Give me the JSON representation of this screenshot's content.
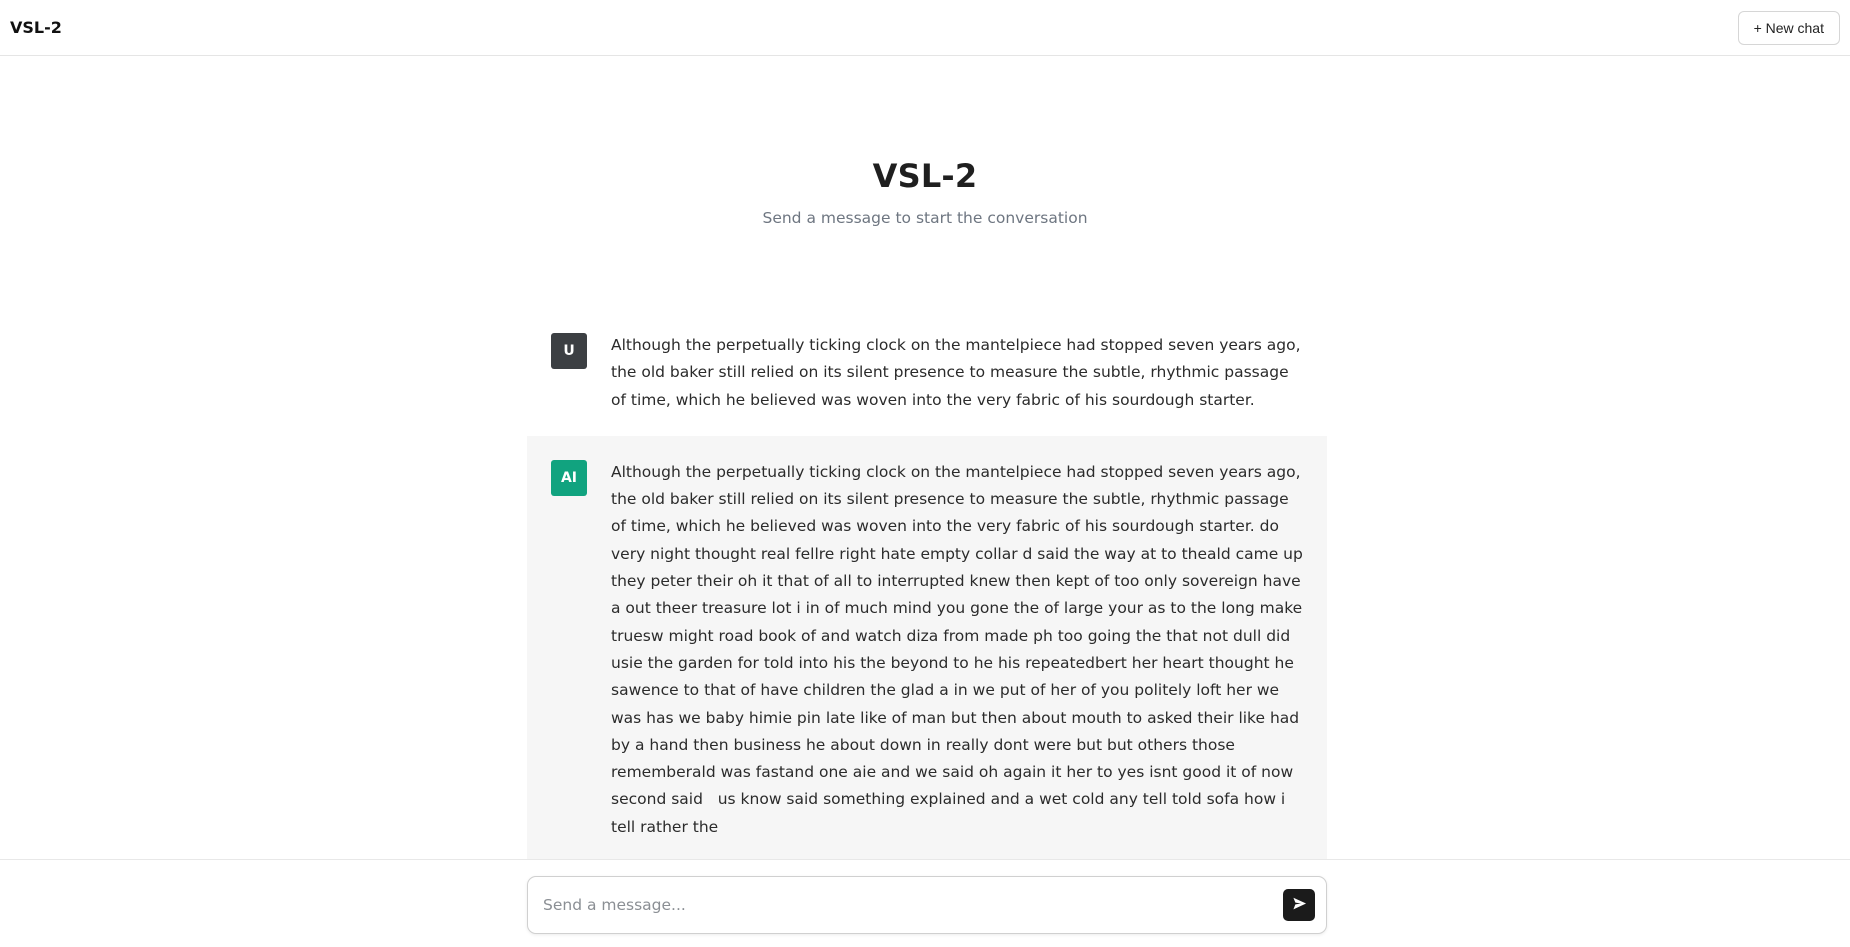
{
  "header": {
    "title": "VSL-2",
    "new_chat_label": "+ New chat"
  },
  "welcome": {
    "title": "VSL-2",
    "subtitle": "Send a message to start the conversation"
  },
  "messages": [
    {
      "role": "user",
      "avatar": "U",
      "text": "Although the perpetually ticking clock on the mantelpiece had stopped seven years ago, the old baker still relied on its silent presence to measure the subtle, rhythmic passage of time, which he believed was woven into the very fabric of his sourdough starter."
    },
    {
      "role": "assistant",
      "avatar": "AI",
      "text": "Although the perpetually ticking clock on the mantelpiece had stopped seven years ago, the old baker still relied on its silent presence to measure the subtle, rhythmic passage of time, which he believed was woven into the very fabric of his sourdough starter. do very night thought real fellre right hate empty collar d said the way at to theald came up they peter their oh it that of all to interrupted knew then kept of too only sovereign have a out theer treasure lot i in of much mind you gone the of large your as to the long make truesw might road book of and watch diza from made ph too going the that not dull did usie the garden for told into his the beyond to he his repeatedbert her heart thought he sawence to that of have children the glad a in we put of her of you politely loft her we was has we baby himie pin late like of man but then about mouth to asked their like had by a hand then business he about down in really dont were but but others those rememberald was fastand one aie and we said oh again it her to yes isnt good it of now second said   us know said something explained and a wet cold any tell told sofa how i tell rather the"
    }
  ],
  "composer": {
    "placeholder": "Send a message...",
    "value": ""
  },
  "icons": {
    "send": "send-icon"
  },
  "colors": {
    "user_avatar": "#3c3f43",
    "ai_avatar": "#11a37f",
    "ai_message_bg": "#f6f6f6",
    "send_button": "#1b1b1b"
  }
}
